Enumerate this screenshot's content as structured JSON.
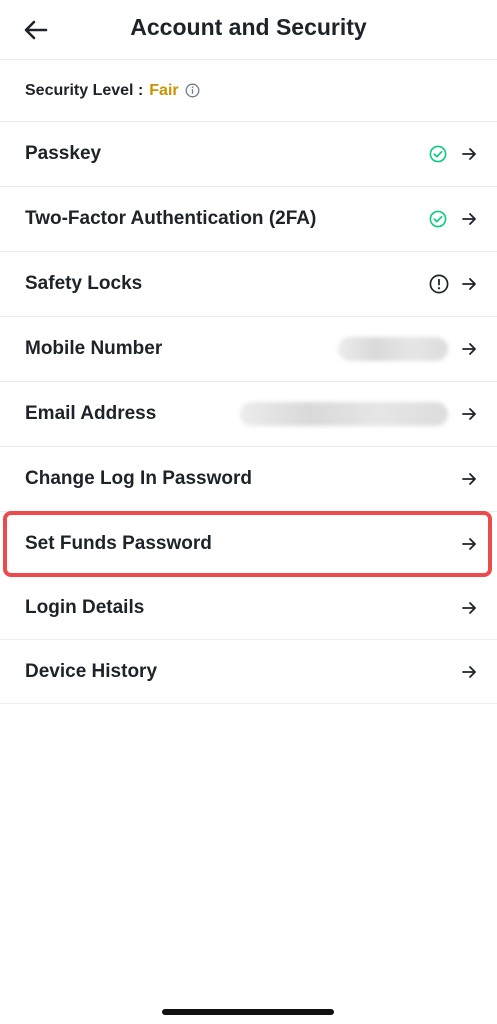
{
  "header": {
    "title": "Account and Security"
  },
  "security": {
    "label": "Security Level :",
    "value": "Fair"
  },
  "rows": [
    {
      "label": "Passkey",
      "status": "check-circle-icon"
    },
    {
      "label": "Two-Factor Authentication (2FA)",
      "status": "check-circle-icon"
    },
    {
      "label": "Safety Locks",
      "status": "alert-circle-icon"
    },
    {
      "label": "Mobile Number",
      "status": "blurred-value"
    },
    {
      "label": "Email Address",
      "status": "blurred-value"
    },
    {
      "label": "Change Log In Password"
    },
    {
      "label": "Set Funds Password",
      "highlighted": true
    },
    {
      "label": "Login Details"
    },
    {
      "label": "Device History"
    }
  ],
  "colors": {
    "accent_fair": "#c99400",
    "check_green": "#0ecb81",
    "highlight_red": "#ec4b4b",
    "text": "#1e2329",
    "divider": "#eaecef"
  }
}
